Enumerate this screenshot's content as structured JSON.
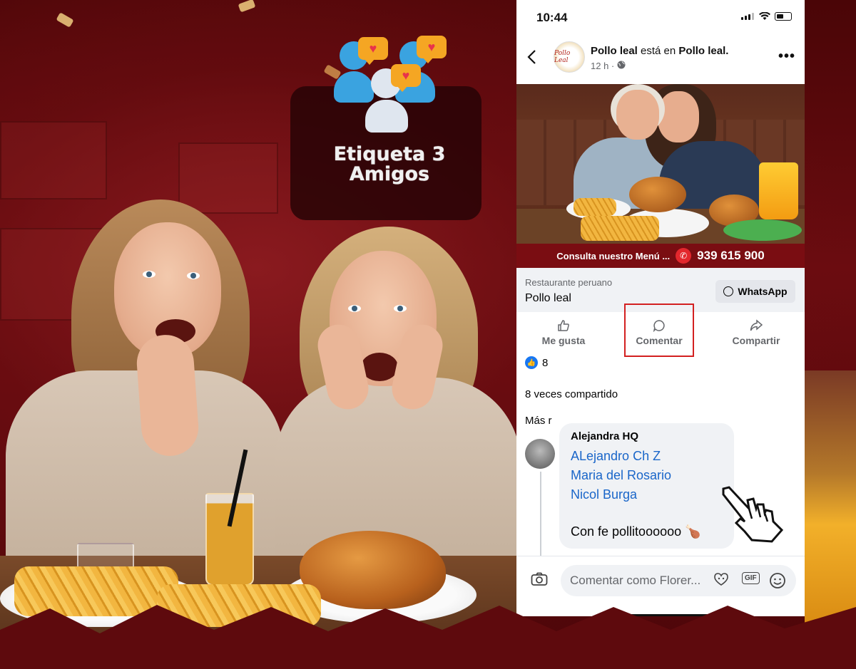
{
  "promo": {
    "title_line1": "Etiqueta 3",
    "title_line2": "Amigos",
    "accent_color": "#f5a623",
    "background_color": "#5e0a0d"
  },
  "status_bar": {
    "time": "10:44"
  },
  "post": {
    "page_name": "Pollo leal",
    "location_text": "está en",
    "location": "Pollo leal.",
    "time_ago": "12 h",
    "privacy_icon": "globe-icon",
    "avatar_text": "Pollo Leal",
    "image_banner_text": "Consulta nuestro Menú ...",
    "image_phone": "939 615 900"
  },
  "cta": {
    "category": "Restaurante peruano",
    "name": "Pollo leal",
    "button_label": "WhatsApp"
  },
  "actions": {
    "like": "Me gusta",
    "comment": "Comentar",
    "share": "Compartir",
    "highlighted": "Comentar",
    "highlight_color": "#d32020"
  },
  "stats": {
    "reaction_count": "8",
    "shares": "8 veces compartido",
    "sort_label": "Más r"
  },
  "comment": {
    "author": "Alejandra HQ",
    "tags": [
      "ALejandro Ch Z",
      "Maria del Rosario",
      "Nicol Burga"
    ],
    "text": "Con fe pollitoooooo",
    "emoji": "🍗",
    "tag_color": "#1a66c9"
  },
  "composer": {
    "placeholder": "Comentar como Florer...",
    "gif_label": "GIF"
  }
}
